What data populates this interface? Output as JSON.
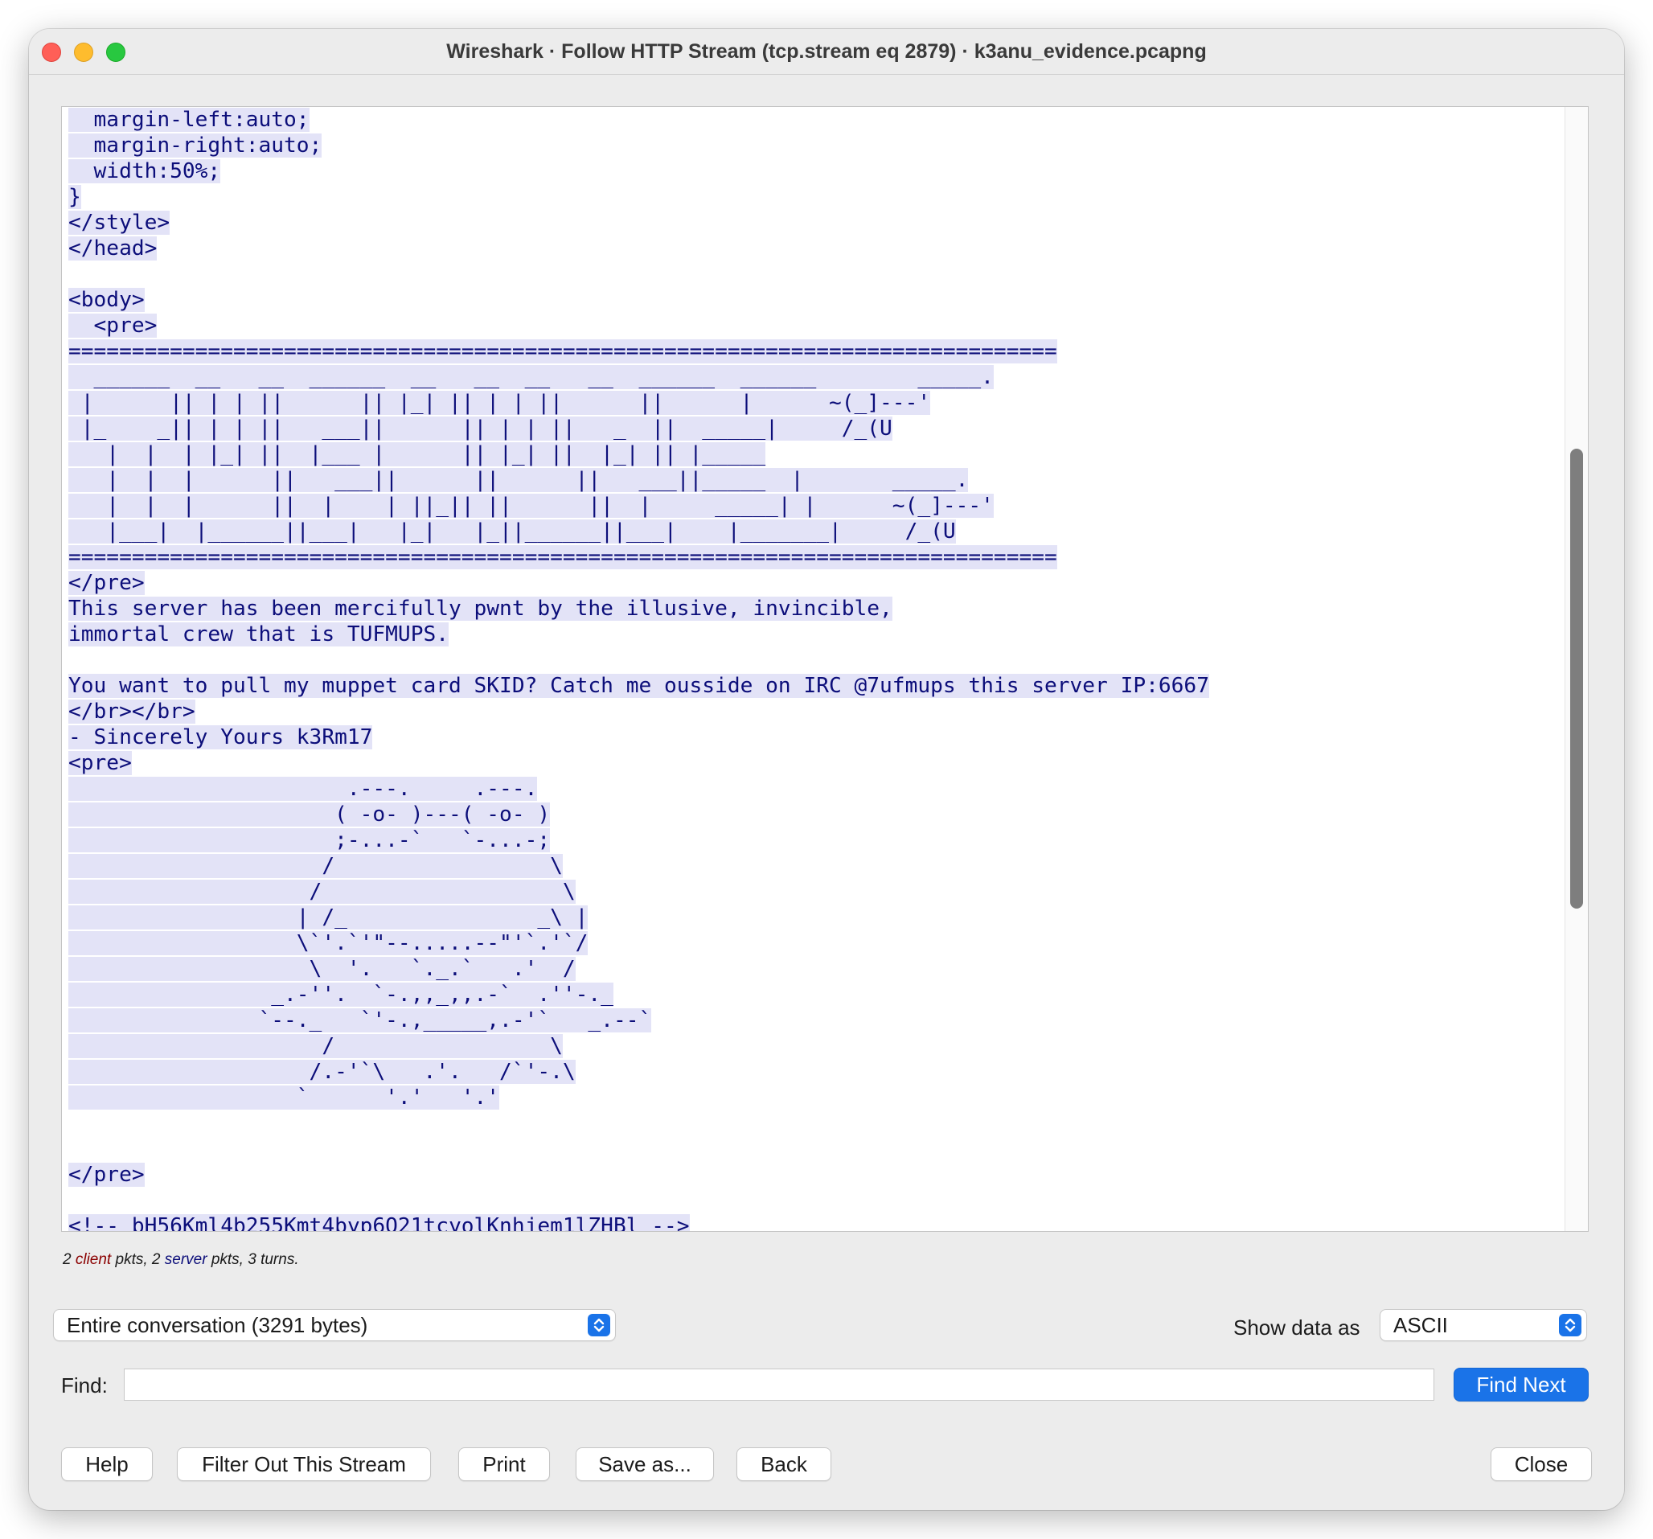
{
  "window": {
    "title": "Wireshark · Follow HTTP Stream (tcp.stream eq 2879) · k3anu_evidence.pcapng"
  },
  "stream": {
    "lines": [
      "  margin-left:auto;",
      "  margin-right:auto;",
      "  width:50%;",
      "}",
      "</style>",
      "</head>",
      "",
      "<body>",
      "  <pre>",
      "==============================================================================",
      "  ______  __   __  ______  __   __  __   __  ______  ______        _____.",
      " |      || | | ||      || |_| || | | ||      ||      |      ~(_]---'",
      " |_    _|| | | ||   ___||      || | | ||   _  ||  _____|     /_(U",
      "   |  |  | |_| ||  |___ |      || |_| ||  |_| || |_____",
      "   |  |  |      ||   ___||      ||      ||   ___||_____  |       _____.",
      "   |  |  |      ||  |    | ||_|| ||      ||  |     _____| |      ~(_]---'",
      "   |___|  |______||___|   |_|   |_||______||___|    |_______|     /_(U",
      "==============================================================================",
      "</pre>",
      "This server has been mercifully pwnt by the illusive, invincible,",
      "immortal crew that is TUFMUPS.",
      "",
      "You want to pull my muppet card SKID? Catch me ousside on IRC @7ufmups this server IP:6667",
      "</br></br>",
      "- Sincerely Yours k3Rm17",
      "<pre>",
      "                      .---.     .---.",
      "                     ( -o- )---( -o- )",
      "                     ;-...-`   `-...-;",
      "                    /                 \\",
      "                   /                   \\",
      "                  | /_               _\\ |",
      "                  \\`'.`'\"--.....--\"'`.'`/",
      "                   \\  '.   `._.`   .'  /",
      "                _.-''.  `-.,,_,,.-`  .''-._",
      "               `--._   `'-.,_____,.-'`   _.--`",
      "                    /                 \\",
      "                   /.-'`\\   .'.   /`'-.\\",
      "                  `      '.'   '.'",
      "",
      "",
      "</pre>",
      "",
      "<!-- bH56Kml4b255Kmt4byp6O21tcyolKnhjem1lZHBl -->"
    ]
  },
  "stats": {
    "count_client": "2",
    "client_word": "client",
    "pkts_middle": " pkts, 2 ",
    "server_word": "server",
    "pkts_end": " pkts, 3 turns."
  },
  "controls": {
    "conversation_select": "Entire conversation (3291 bytes)",
    "show_data_label": "Show data as",
    "show_data_select": "ASCII",
    "find_label": "Find:",
    "find_value": "",
    "find_next": "Find Next"
  },
  "buttons": {
    "help": "Help",
    "filter_out": "Filter Out This Stream",
    "print": "Print",
    "save_as": "Save as...",
    "back": "Back",
    "close": "Close"
  },
  "colors": {
    "client_text": "#8b0000",
    "server_text": "#0c0e7a",
    "highlight_bg": "#e3e3f7",
    "accent": "#1a73e8"
  }
}
